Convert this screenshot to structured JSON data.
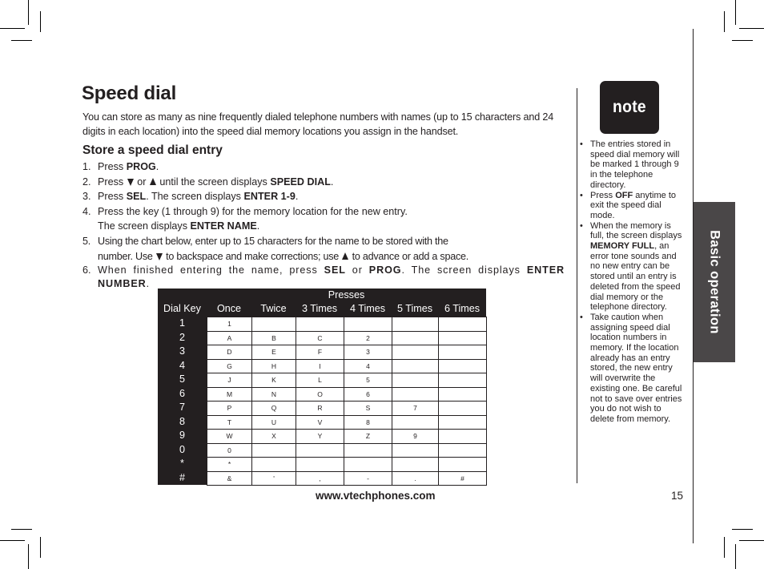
{
  "page": {
    "title": "Speed dial",
    "intro": "You can store as many as nine frequently dialed telephone numbers with names (up to 15 characters and 24 digits in each location) into the speed dial memory locations you assign in the handset.",
    "subheading": "Store a speed dial entry",
    "steps": [
      {
        "num": "1.",
        "parts": [
          "Press ",
          "PROG",
          "."
        ]
      },
      {
        "num": "2.",
        "parts": [
          "Press ",
          "down-arrow-icon",
          " or ",
          "up-arrow-icon",
          " until the screen displays ",
          "SPEED DIAL",
          "."
        ]
      },
      {
        "num": "3.",
        "parts": [
          "Press ",
          "SEL",
          ". The screen displays ",
          "ENTER 1-9",
          "."
        ]
      },
      {
        "num": "4.",
        "line1": "Press the key (1 through 9) for the memory location for the new entry.",
        "line2_pre": "The screen displays ",
        "line2_bold": "ENTER NAME",
        "line2_post": "."
      },
      {
        "num": "5.",
        "line1": "Using the chart below, enter up to 15 characters for the name to be stored with the",
        "line2_a": "number. Use ",
        "line2_b": " to backspace and make corrections; use ",
        "line2_c": " to advance or add a space."
      },
      {
        "num": "6.",
        "a": "When finished entering the name, press ",
        "b": "SEL",
        "c": " or ",
        "d": "PROG",
        "e": ". The screen displays ",
        "f": "ENTER NUMBER",
        "g": "."
      }
    ],
    "footer_url": "www.vtechphones.com",
    "page_number": "15",
    "section_tab": "Basic operation"
  },
  "char_table": {
    "group_header": "Presses",
    "columns": [
      "Dial Key",
      "Once",
      "Twice",
      "3 Times",
      "4 Times",
      "5 Times",
      "6 Times"
    ],
    "rows": [
      {
        "key": "1",
        "cells": [
          "1",
          "",
          "",
          "",
          "",
          ""
        ]
      },
      {
        "key": "2",
        "cells": [
          "A",
          "B",
          "C",
          "2",
          "",
          ""
        ]
      },
      {
        "key": "3",
        "cells": [
          "D",
          "E",
          "F",
          "3",
          "",
          ""
        ]
      },
      {
        "key": "4",
        "cells": [
          "G",
          "H",
          "I",
          "4",
          "",
          ""
        ]
      },
      {
        "key": "5",
        "cells": [
          "J",
          "K",
          "L",
          "5",
          "",
          ""
        ]
      },
      {
        "key": "6",
        "cells": [
          "M",
          "N",
          "O",
          "6",
          "",
          ""
        ]
      },
      {
        "key": "7",
        "cells": [
          "P",
          "Q",
          "R",
          "S",
          "7",
          ""
        ]
      },
      {
        "key": "8",
        "cells": [
          "T",
          "U",
          "V",
          "8",
          "",
          ""
        ]
      },
      {
        "key": "9",
        "cells": [
          "W",
          "X",
          "Y",
          "Z",
          "9",
          ""
        ]
      },
      {
        "key": "0",
        "cells": [
          "0",
          "",
          "",
          "",
          "",
          ""
        ]
      },
      {
        "key": "*",
        "cells": [
          "*",
          "",
          "",
          "",
          "",
          ""
        ]
      },
      {
        "key": "#",
        "cells": [
          "&",
          "'",
          ",",
          "-",
          ".",
          "#"
        ]
      }
    ]
  },
  "note": {
    "label": "note",
    "items": [
      {
        "text": "The entries stored in speed dial memory will be marked 1 through 9 in the telephone directory."
      },
      {
        "pre": "Press ",
        "bold": "OFF",
        "post": " anytime to exit the speed dial mode."
      },
      {
        "pre": "When the memory is full, the screen displays ",
        "bold": "MEMORY FULL",
        "post": ", an error tone sounds and no new entry can be stored until an entry is deleted from the speed dial memory or the telephone directory."
      },
      {
        "text": "Take caution when assigning speed dial location numbers in memory. If the location already has an entry stored, the new entry will overwrite the existing one. Be careful not to save over entries you do not wish to delete from memory."
      }
    ]
  }
}
